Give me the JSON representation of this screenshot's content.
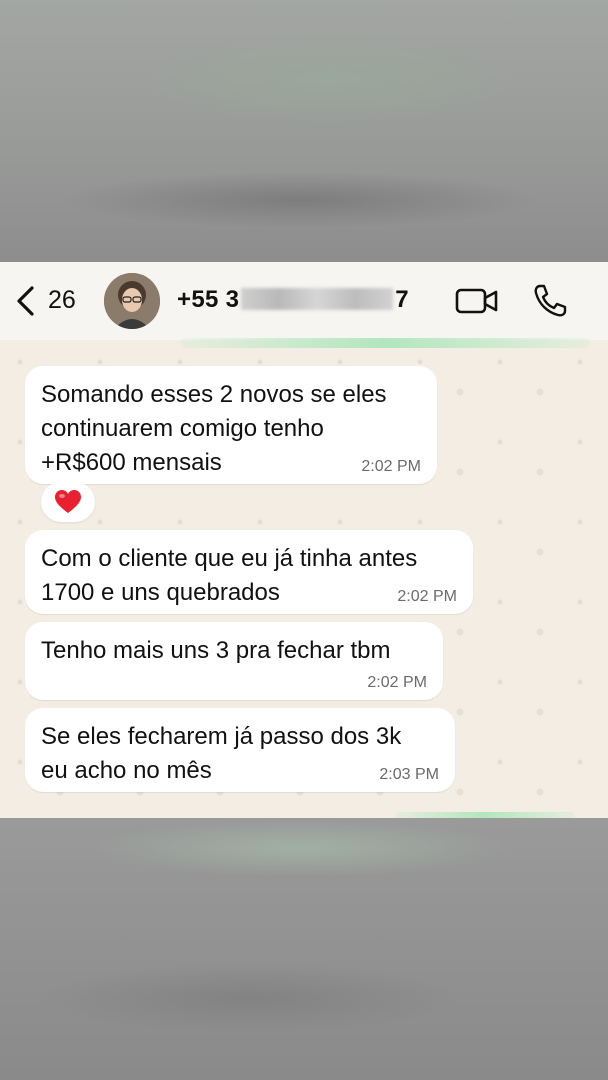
{
  "header": {
    "back_count": "26",
    "contact_prefix": "+55 3",
    "contact_suffix": "7"
  },
  "messages": [
    {
      "text": "Somando esses 2 novos se eles\ncontinuarem comigo tenho\n+R$600 mensais",
      "time": "2:02 PM",
      "reaction": "heart"
    },
    {
      "text": "Com o cliente que eu já tinha antes\n1700 e uns quebrados",
      "time": "2:02 PM"
    },
    {
      "text": "Tenho mais uns 3 pra fechar tbm",
      "time": "2:02 PM"
    },
    {
      "text": "Se eles fecharem já passo dos 3k\neu acho no mês",
      "time": "2:03 PM"
    }
  ],
  "colors": {
    "chat_background": "#f3ede3",
    "bubble": "#ffffff",
    "reaction_heart": "#e8202f"
  },
  "icons": [
    "back-chevron-icon",
    "video-call-icon",
    "phone-call-icon",
    "heart-reaction-icon"
  ]
}
